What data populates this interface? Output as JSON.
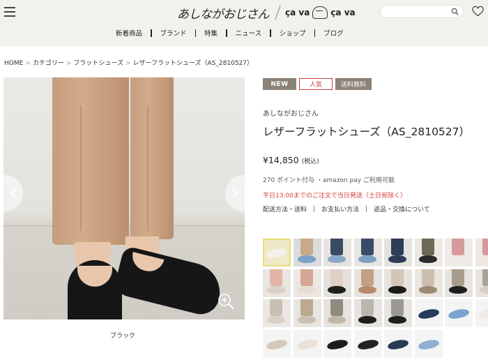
{
  "header": {
    "logo_text": "あしながおじさん",
    "logo_secondary": "ça va",
    "logo_mark_text": "",
    "logo_tertiary": "ça va",
    "search_placeholder": "",
    "nav": [
      "新着商品",
      "ブランド",
      "特集",
      "ニュース",
      "ショップ",
      "ブログ"
    ]
  },
  "breadcrumb": [
    "HOME",
    "カテゴリー",
    "フラットシューズ",
    "レザーフラットシューズ（AS_2810527）"
  ],
  "product": {
    "badges": {
      "new": "NEW",
      "popular": "人気",
      "shipping": "送料無料"
    },
    "brand": "あしながおじさん",
    "title": "レザーフラットシューズ（AS_2810527）",
    "price": "¥14,850",
    "tax_note": "(税込)",
    "points": "270 ポイント付与 ・amazon pay ご利用可能",
    "notice": "平日13:00までのご注文で当日発送（土日祝除く）",
    "links": [
      "配送方法・送料",
      "お支払い方法",
      "返品・交換について"
    ],
    "color_label": "ブラック"
  },
  "colors": {
    "header_bg": "#f3f1ec",
    "badge_gray": "#8b8278",
    "accent_red": "#c9374b",
    "notice_red": "#d93a3a",
    "selected_outline": "#e8dd79"
  },
  "thumbnails": [
    {
      "bg": "#efe9c8",
      "shoe": "#f4f1ea",
      "leg": ""
    },
    {
      "bg": "#dcdcdc",
      "shoe": "#7da0c9",
      "leg": "#c9a98c"
    },
    {
      "bg": "#e6e4e0",
      "shoe": "#8ba7c6",
      "leg": "#3b4a63"
    },
    {
      "bg": "#e8e6e2",
      "shoe": "#7f9fc0",
      "leg": "#3c4c68"
    },
    {
      "bg": "#e4e2de",
      "shoe": "#2c3b57",
      "leg": "#2f3d5a"
    },
    {
      "bg": "#ece9e4",
      "shoe": "#2b2b2b",
      "leg": "#6c6a55"
    },
    {
      "bg": "#eeeae6",
      "shoe": "#f1e9e4",
      "leg": "#d79a9a"
    },
    {
      "bg": "#ece8e4",
      "shoe": "#efe6e0",
      "leg": "#d49aa0"
    },
    {
      "bg": "#e9e6e2",
      "shoe": "#d9cfc4",
      "leg": "#e3b5a8"
    },
    {
      "bg": "#ebe8e4",
      "shoe": "#e7ddd2",
      "leg": "#d6a595"
    },
    {
      "bg": "#e4e1dc",
      "shoe": "#1d1d1d",
      "leg": "#e1cfc3"
    },
    {
      "bg": "#e7e4df",
      "shoe": "#b58a6a",
      "leg": "#c3a085"
    },
    {
      "bg": "#e6e3de",
      "shoe": "#1b1b1b",
      "leg": "#d3c5b8"
    },
    {
      "bg": "#e9e5e0",
      "shoe": "#9e8a74",
      "leg": "#cdbfae"
    },
    {
      "bg": "#e6e3df",
      "shoe": "#1f1f1f",
      "leg": "#a89c8c"
    },
    {
      "bg": "#e7e3de",
      "shoe": "#d7cec5",
      "leg": "#a5a39c"
    },
    {
      "bg": "#ebe8e4",
      "shoe": "#d8cfc6",
      "leg": "#c8c0b5"
    },
    {
      "bg": "#e8e5e0",
      "shoe": "#cbbfb1",
      "leg": "#bba990"
    },
    {
      "bg": "#e6e3de",
      "shoe": "#c2b6a8",
      "leg": "#8f8b7e"
    },
    {
      "bg": "#e7e4df",
      "shoe": "#1e1e1e",
      "leg": "#b9b6ad"
    },
    {
      "bg": "#e8e5e0",
      "shoe": "#1f1f1f",
      "leg": "#9a9a92"
    },
    {
      "bg": "#f4f4f4",
      "shoe": "#2a3a5a",
      "leg": ""
    },
    {
      "bg": "#f4f4f4",
      "shoe": "#7aa3cf",
      "leg": ""
    },
    {
      "bg": "#f4f4f4",
      "shoe": "#f0e8e4",
      "leg": ""
    },
    {
      "bg": "#f4f4f4",
      "shoe": "#d6c9bb",
      "leg": ""
    },
    {
      "bg": "#f4f4f4",
      "shoe": "#e9e1d9",
      "leg": ""
    },
    {
      "bg": "#f4f4f4",
      "shoe": "#1c1c1c",
      "leg": ""
    },
    {
      "bg": "#f4f4f4",
      "shoe": "#222222",
      "leg": ""
    },
    {
      "bg": "#f4f4f4",
      "shoe": "#2b3955",
      "leg": ""
    },
    {
      "bg": "#f4f4f4",
      "shoe": "#8fb0d3",
      "leg": ""
    }
  ]
}
